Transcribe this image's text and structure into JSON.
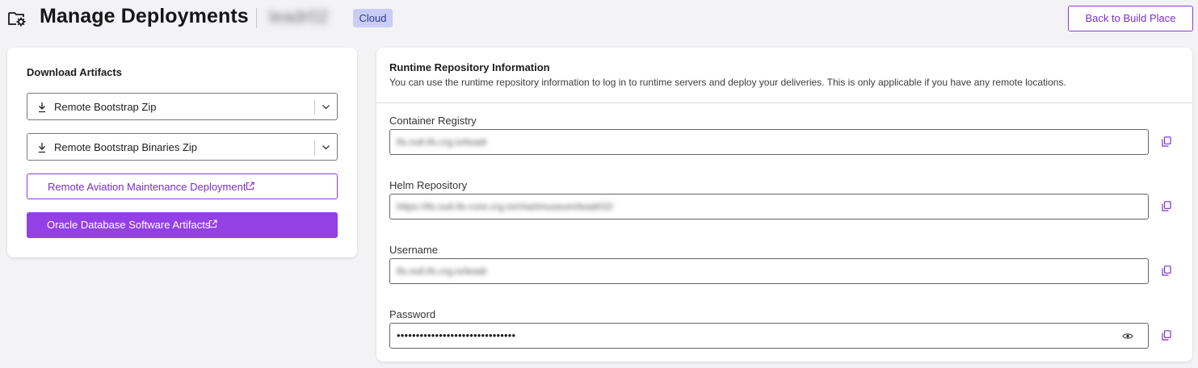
{
  "header": {
    "title": "Manage Deployments",
    "app_name": "leadr02",
    "badge": "Cloud",
    "back_button": "Back to Build Place",
    "page_icon": "folder-gear-icon"
  },
  "download_artifacts": {
    "title": "Download Artifacts",
    "dropdowns": [
      {
        "label": "Remote Bootstrap Zip",
        "icon": "download-icon"
      },
      {
        "label": "Remote Bootstrap Binaries Zip",
        "icon": "download-icon"
      }
    ],
    "outline_button": {
      "label": "Remote Aviation Maintenance Deployment",
      "icon": "external-link-icon"
    },
    "solid_button": {
      "label": "Oracle Database Software Artifacts",
      "icon": "external-link-icon"
    }
  },
  "runtime_repo": {
    "title": "Runtime Repository Information",
    "description": "You can use the runtime repository information to log in to runtime servers and deploy your deliveries. This is only applicable if you have any remote locations.",
    "fields": [
      {
        "label": "Container Registry",
        "value": "ifs.null.ifs.crg.io/leadr"
      },
      {
        "label": "Helm Repository",
        "value": "https://ifs.null.ifs-core.crg.io/chartmuseum/leadr02/"
      },
      {
        "label": "Username",
        "value": "ifs.null.ifs.crg.io/leadr"
      },
      {
        "label": "Password",
        "value": "•••••••••••••••••••••••••••••••"
      }
    ]
  },
  "colors": {
    "accent": "#9340e6",
    "accent_text": "#7a2fd0",
    "badge_bg": "#c9cdf6",
    "page_bg": "#f3f2f5"
  }
}
